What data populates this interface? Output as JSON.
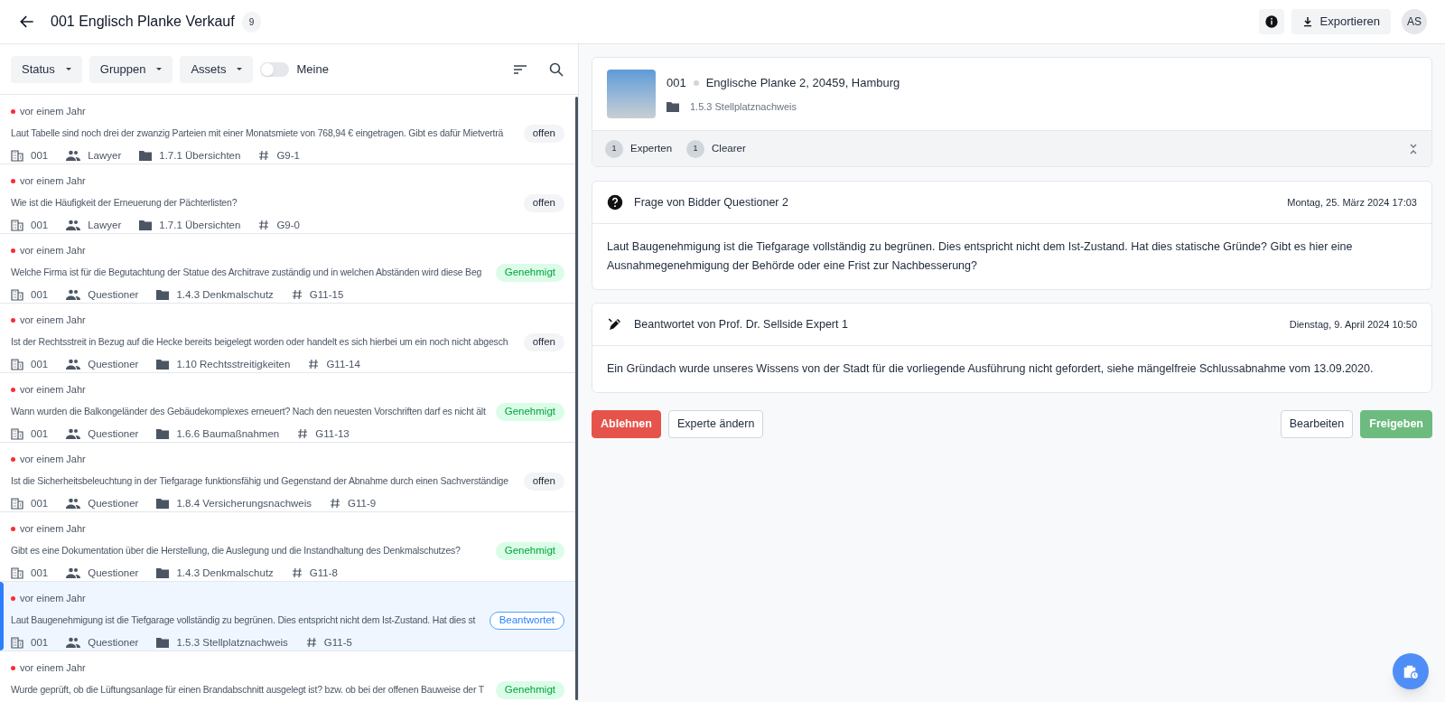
{
  "header": {
    "title": "001 Englisch Planke Verkauf",
    "count": "9",
    "export_label": "Exportieren",
    "avatar": "AS"
  },
  "filters": {
    "dropdowns": [
      "Status",
      "Gruppen",
      "Assets"
    ],
    "toggle": {
      "label": "Meine",
      "on": false
    }
  },
  "questions": [
    {
      "time": "vor einem Jahr",
      "text": "Laut Tabelle sind noch drei der zwanzig Parteien mit einer Monatsmiete von 768,94 € eingetragen. Gibt es dafür Mietverträ",
      "status": {
        "kind": "open",
        "label": "offen"
      },
      "asset": "001",
      "group": "Lawyer",
      "folder": "1.7.1 Übersichten",
      "ref": "G9-1",
      "selected": false
    },
    {
      "time": "vor einem Jahr",
      "text": "Wie ist die Häufigkeit der Erneuerung der Pächterlisten?",
      "status": {
        "kind": "open",
        "label": "offen"
      },
      "asset": "001",
      "group": "Lawyer",
      "folder": "1.7.1 Übersichten",
      "ref": "G9-0",
      "selected": false
    },
    {
      "time": "vor einem Jahr",
      "text": "Welche Firma ist für die Begutachtung der Statue des Architrave zuständig und in welchen Abständen wird diese Beg",
      "status": {
        "kind": "approved",
        "label": "Genehmigt"
      },
      "asset": "001",
      "group": "Questioner",
      "folder": "1.4.3 Denkmalschutz",
      "ref": "G11-15",
      "selected": false
    },
    {
      "time": "vor einem Jahr",
      "text": "Ist der Rechtsstreit in Bezug auf die Hecke bereits beigelegt worden oder handelt es sich hierbei um ein noch nicht abgesch",
      "status": {
        "kind": "open",
        "label": "offen"
      },
      "asset": "001",
      "group": "Questioner",
      "folder": "1.10 Rechtsstreitigkeiten",
      "ref": "G11-14",
      "selected": false
    },
    {
      "time": "vor einem Jahr",
      "text": "Wann wurden die Balkongeländer des Gebäudekomplexes erneuert? Nach den neuesten Vorschriften darf es nicht ält",
      "status": {
        "kind": "approved",
        "label": "Genehmigt"
      },
      "asset": "001",
      "group": "Questioner",
      "folder": "1.6.6 Baumaßnahmen",
      "ref": "G11-13",
      "selected": false
    },
    {
      "time": "vor einem Jahr",
      "text": "Ist die Sicherheitsbeleuchtung in der Tiefgarage funktionsfähig und Gegenstand der Abnahme durch einen Sachverständige",
      "status": {
        "kind": "open",
        "label": "offen"
      },
      "asset": "001",
      "group": "Questioner",
      "folder": "1.8.4 Versicherungsnachweis",
      "ref": "G11-9",
      "selected": false
    },
    {
      "time": "vor einem Jahr",
      "text": "Gibt es eine Dokumentation über die Herstellung, die Auslegung und die Instandhaltung des Denkmalschutzes?",
      "status": {
        "kind": "approved",
        "label": "Genehmigt"
      },
      "asset": "001",
      "group": "Questioner",
      "folder": "1.4.3 Denkmalschutz",
      "ref": "G11-8",
      "selected": false
    },
    {
      "time": "vor einem Jahr",
      "text": "Laut Baugenehmigung ist die Tiefgarage vollständig zu begrünen. Dies entspricht nicht dem Ist-Zustand. Hat dies st",
      "status": {
        "kind": "answered",
        "label": "Beantwortet"
      },
      "asset": "001",
      "group": "Questioner",
      "folder": "1.5.3 Stellplatznachweis",
      "ref": "G11-5",
      "selected": true
    },
    {
      "time": "vor einem Jahr",
      "text": "Wurde geprüft, ob die Lüftungsanlage für einen Brandabschnitt ausgelegt ist? bzw. ob bei der offenen Bauweise der T",
      "status": {
        "kind": "approved",
        "label": "Genehmigt"
      },
      "selected": false
    }
  ],
  "detail": {
    "asset": {
      "number": "001",
      "address": "Englische Planke 2, 20459, Hamburg",
      "folder": "1.5.3 Stellplatznachweis",
      "roles": [
        {
          "count": "1",
          "label": "Experten"
        },
        {
          "count": "1",
          "label": "Clearer"
        }
      ]
    },
    "messages": [
      {
        "kind": "question",
        "title": "Frage von Bidder Questioner 2",
        "date": "Montag, 25. März 2024 17:03",
        "body": "Laut Baugenehmigung ist die Tiefgarage vollständig zu begrünen. Dies entspricht nicht dem Ist-Zustand. Hat dies statische Gründe? Gibt es hier eine Ausnahmegenehmigung der Behörde oder eine Frist zur Nachbesserung?"
      },
      {
        "kind": "answer",
        "title": "Beantwortet von Prof. Dr. Sellside Expert 1",
        "date": "Dienstag, 9. April 2024 10:50",
        "body": "Ein Gründach wurde unseres Wissens von der Stadt für die vorliegende Ausführung nicht gefordert, siehe mängelfreie Schlussabnahme vom 13.09.2020."
      }
    ],
    "actions_left": [
      {
        "kind": "danger",
        "label": "Ablehnen"
      },
      {
        "kind": "outline",
        "label": "Experte ändern"
      }
    ],
    "actions_right": [
      {
        "kind": "outline",
        "label": "Bearbeiten"
      },
      {
        "kind": "success",
        "label": "Freigeben"
      }
    ]
  }
}
